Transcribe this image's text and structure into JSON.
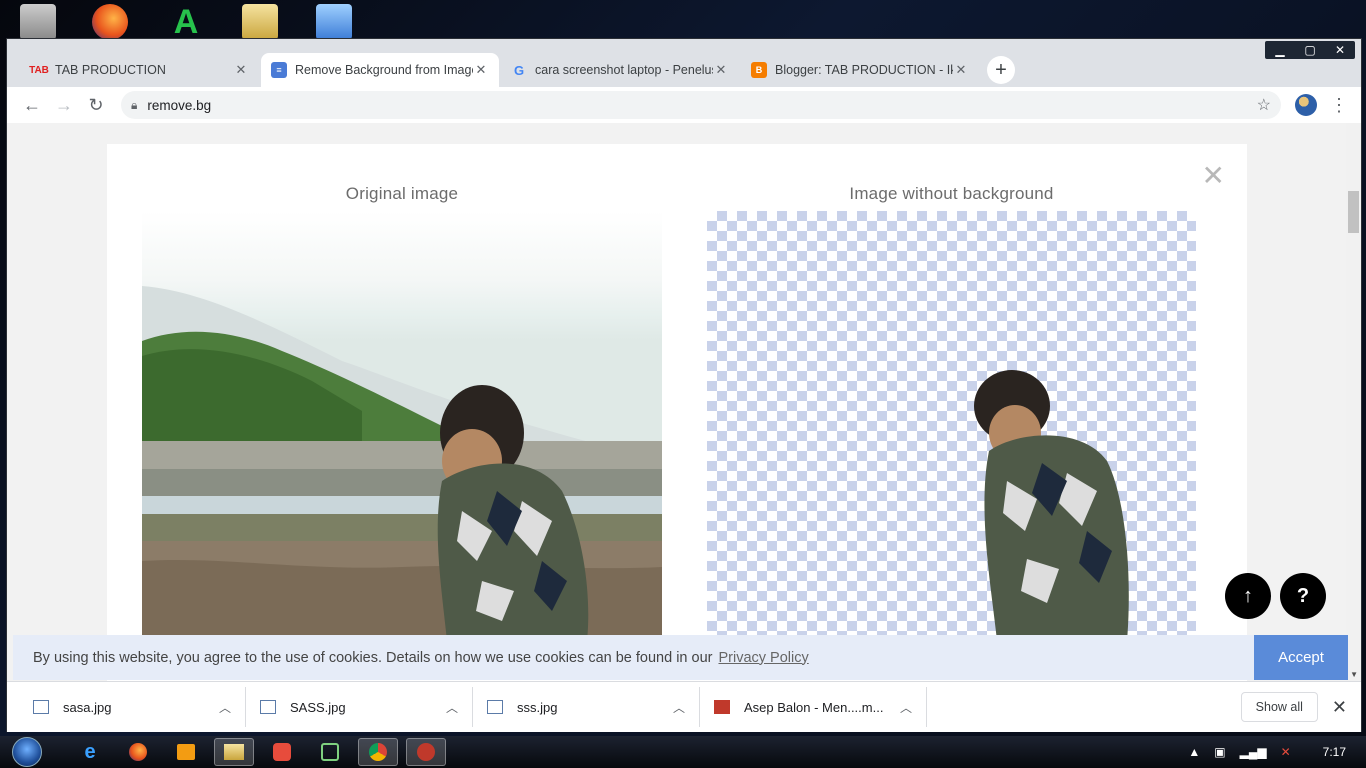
{
  "browser": {
    "tabs": [
      {
        "title": "TAB PRODUCTION",
        "favicon": "tab-production-icon",
        "active": false
      },
      {
        "title": "Remove Background from Image",
        "favicon": "remove-bg-icon",
        "active": true
      },
      {
        "title": "cara screenshot laptop - Penelusuran",
        "favicon": "google-icon",
        "active": false
      },
      {
        "title": "Blogger: TAB PRODUCTION - Ikhtisar",
        "favicon": "blogger-icon",
        "active": false
      }
    ],
    "url": "remove.bg"
  },
  "modal": {
    "original_title": "Original image",
    "result_title": "Image without background",
    "close_icon": "close-icon"
  },
  "fab": {
    "scroll_top_icon": "↑",
    "help_label": "?"
  },
  "cookie": {
    "message": "By using this website, you agree to the use of cookies. Details on how we use cookies can be found in our",
    "link": "Privacy Policy",
    "accept": "Accept"
  },
  "downloads": {
    "items": [
      {
        "name": "sasa.jpg",
        "icon": "image-file-icon"
      },
      {
        "name": "SASS.jpg",
        "icon": "image-file-icon"
      },
      {
        "name": "sss.jpg",
        "icon": "image-file-icon"
      },
      {
        "name": "Asep Balon - Men....m...",
        "icon": "audio-file-icon"
      }
    ],
    "show_all": "Show all"
  },
  "taskbar": {
    "clock": "7:17"
  },
  "colors": {
    "accent": "#5a8bd9",
    "checker": "#c9d2ea",
    "cookie_bg": "#e6ecf8"
  }
}
